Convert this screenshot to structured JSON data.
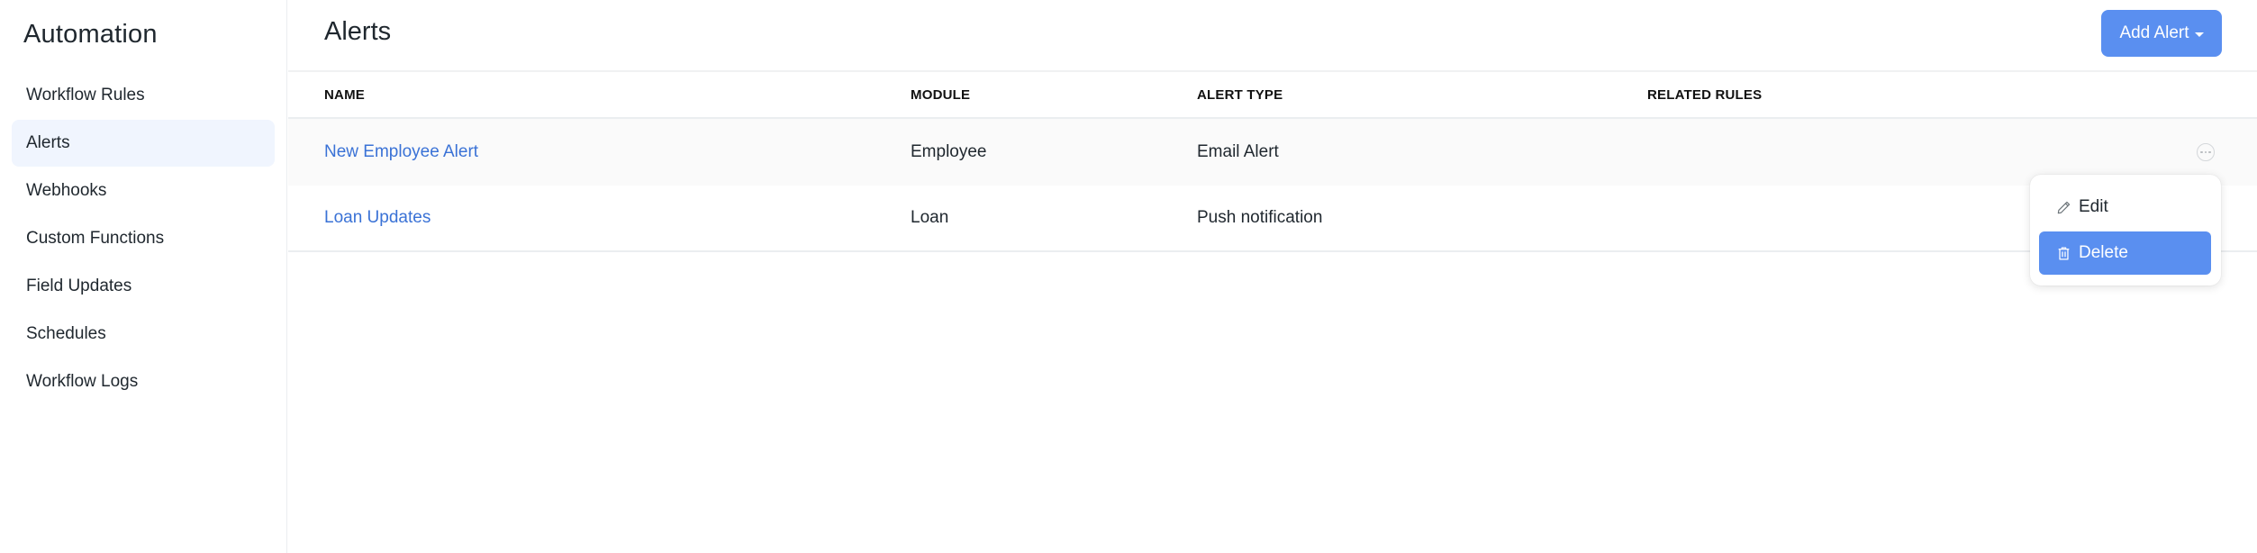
{
  "sidebar": {
    "title": "Automation",
    "items": [
      {
        "label": "Workflow Rules",
        "active": false
      },
      {
        "label": "Alerts",
        "active": true
      },
      {
        "label": "Webhooks",
        "active": false
      },
      {
        "label": "Custom Functions",
        "active": false
      },
      {
        "label": "Field Updates",
        "active": false
      },
      {
        "label": "Schedules",
        "active": false
      },
      {
        "label": "Workflow Logs",
        "active": false
      }
    ]
  },
  "header": {
    "title": "Alerts",
    "add_button_label": "Add Alert",
    "add_button_icon": "caret-down-icon"
  },
  "table": {
    "columns": [
      "NAME",
      "MODULE",
      "ALERT TYPE",
      "RELATED RULES"
    ],
    "rows": [
      {
        "name": "New Employee Alert",
        "module": "Employee",
        "alert_type": "Email Alert",
        "related_rules": ""
      },
      {
        "name": "Loan Updates",
        "module": "Loan",
        "alert_type": "Push notification",
        "related_rules": ""
      }
    ]
  },
  "row_menu": {
    "trigger_icon": "more-horizontal-icon",
    "items": [
      {
        "label": "Edit",
        "icon": "pencil-icon",
        "highlighted": false
      },
      {
        "label": "Delete",
        "icon": "trash-icon",
        "highlighted": true
      }
    ]
  },
  "colors": {
    "primary": "#5a8ff0",
    "link": "#3a72d6",
    "active_nav_bg": "#f0f5fe",
    "row_hover_bg": "#fafafa"
  }
}
